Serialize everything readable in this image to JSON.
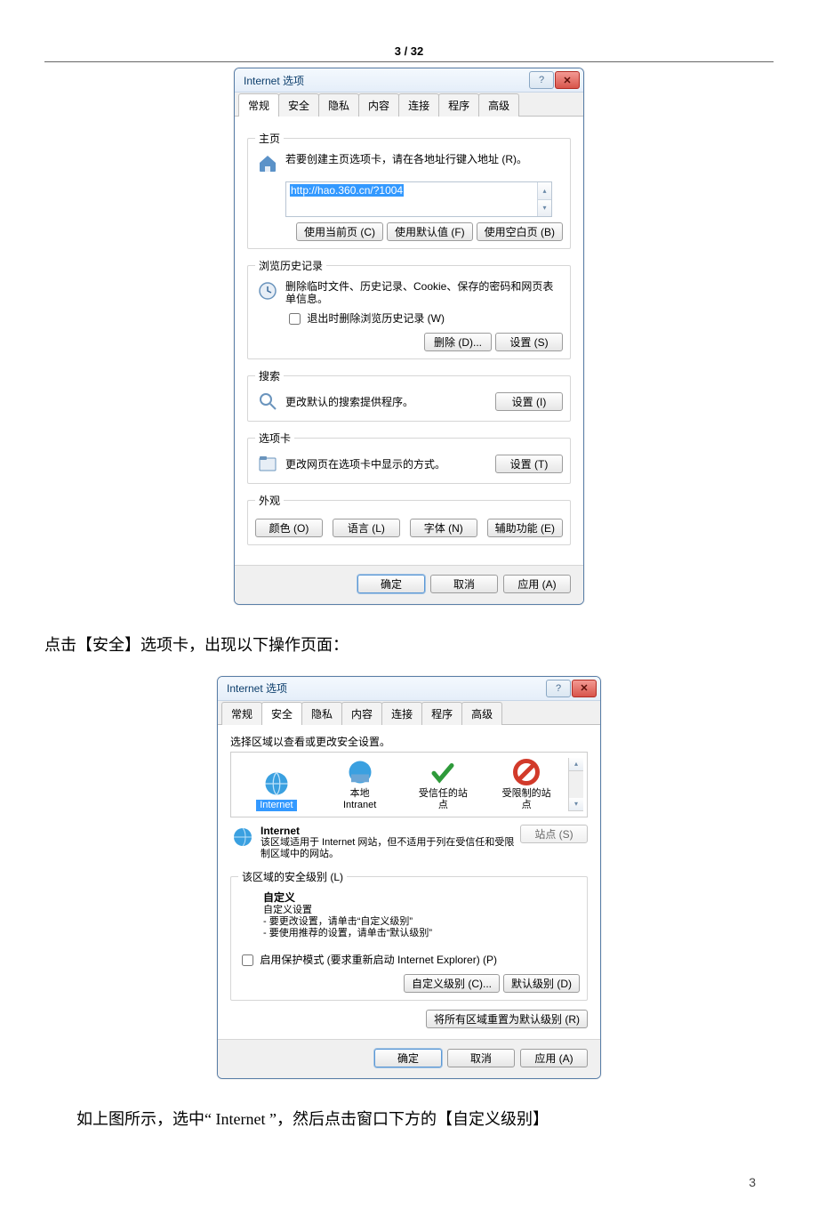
{
  "header": {
    "pager": "3 / 32"
  },
  "dlg_title": "Internet 选项",
  "tabs1": [
    "常规",
    "安全",
    "隐私",
    "内容",
    "连接",
    "程序",
    "高级"
  ],
  "tabs2": [
    "常规",
    "安全",
    "隐私",
    "内容",
    "连接",
    "程序",
    "高级"
  ],
  "d1": {
    "home_legend": "主页",
    "home_desc": "若要创建主页选项卡，请在各地址行键入地址 (R)。",
    "home_url": "http://hao.360.cn/?1004",
    "btn_use_current": "使用当前页 (C)",
    "btn_use_default": "使用默认值 (F)",
    "btn_use_blank": "使用空白页 (B)",
    "hist_legend": "浏览历史记录",
    "hist_desc": "删除临时文件、历史记录、Cookie、保存的密码和网页表单信息。",
    "hist_checkbox": "退出时删除浏览历史记录 (W)",
    "btn_delete": "删除 (D)...",
    "btn_settings": "设置 (S)",
    "search_legend": "搜索",
    "search_desc": "更改默认的搜索提供程序。",
    "btn_search_settings": "设置 (I)",
    "tabs_legend": "选项卡",
    "tabs_desc": "更改网页在选项卡中显示的方式。",
    "btn_tabs_settings": "设置 (T)",
    "appear_legend": "外观",
    "btn_colors": "颜色 (O)",
    "btn_lang": "语言 (L)",
    "btn_fonts": "字体 (N)",
    "btn_access": "辅助功能 (E)"
  },
  "para1": "点击【安全】选项卡，出现以下操作页面：",
  "d2": {
    "zone_prompt": "选择区域以查看或更改安全设置。",
    "zone_internet": "Internet",
    "zone_intranet": "本地\nIntranet",
    "zone_trusted": "受信任的站\n点",
    "zone_restricted": "受限制的站\n点",
    "sel_zone_title": "Internet",
    "sel_zone_desc": "该区域适用于 Internet 网站，但不适用于列在受信任和受限制区域中的网站。",
    "btn_sites": "站点 (S)",
    "level_legend": "该区域的安全级别 (L)",
    "level_name": "自定义",
    "level_sub": "自定义设置",
    "level_line1": "- 要更改设置，请单击“自定义级别”",
    "level_line2": "- 要使用推荐的设置，请单击“默认级别”",
    "protected": "启用保护模式 (要求重新启动 Internet Explorer) (P)",
    "btn_custom": "自定义级别 (C)...",
    "btn_default_level": "默认级别 (D)",
    "btn_reset_all": "将所有区域重置为默认级别 (R)"
  },
  "bottom": {
    "ok": "确定",
    "cancel": "取消",
    "apply": "应用 (A)"
  },
  "para2": "如上图所示，选中“   Internet ”，然后点击窗口下方的【自定义级别】",
  "footer_page": "3"
}
